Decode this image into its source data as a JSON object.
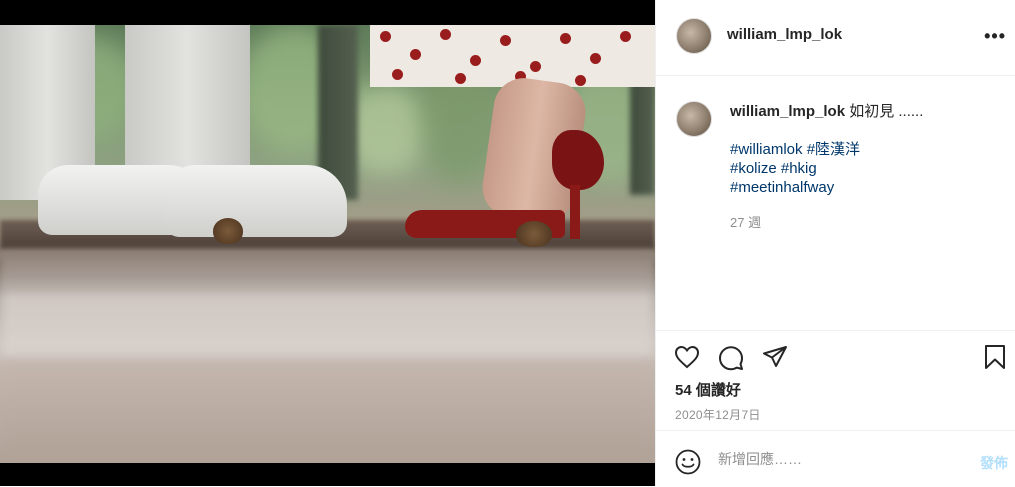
{
  "post": {
    "username": "william_lmp_lok",
    "caption": "如初見 ......",
    "hashtags": [
      "#williamlok",
      "#陸漢洋",
      "#kolize",
      "#hkig",
      "#meetinhalfway"
    ],
    "age": "27 週",
    "likes": "54 個讚好",
    "date": "2020年12月7日"
  },
  "header": {
    "more_icon": "more-horizontal-icon"
  },
  "actions": {
    "like_icon": "heart-icon",
    "comment_icon": "comment-icon",
    "share_icon": "paper-plane-icon",
    "save_icon": "bookmark-icon"
  },
  "comment": {
    "placeholder": "新增回應……",
    "post_label": "發佈",
    "emoji_icon": "emoji-icon",
    "post_color": "#b2dffc"
  },
  "colors": {
    "hashtag": "#00376b",
    "muted": "#8e8e8e",
    "divider": "#efefef"
  }
}
